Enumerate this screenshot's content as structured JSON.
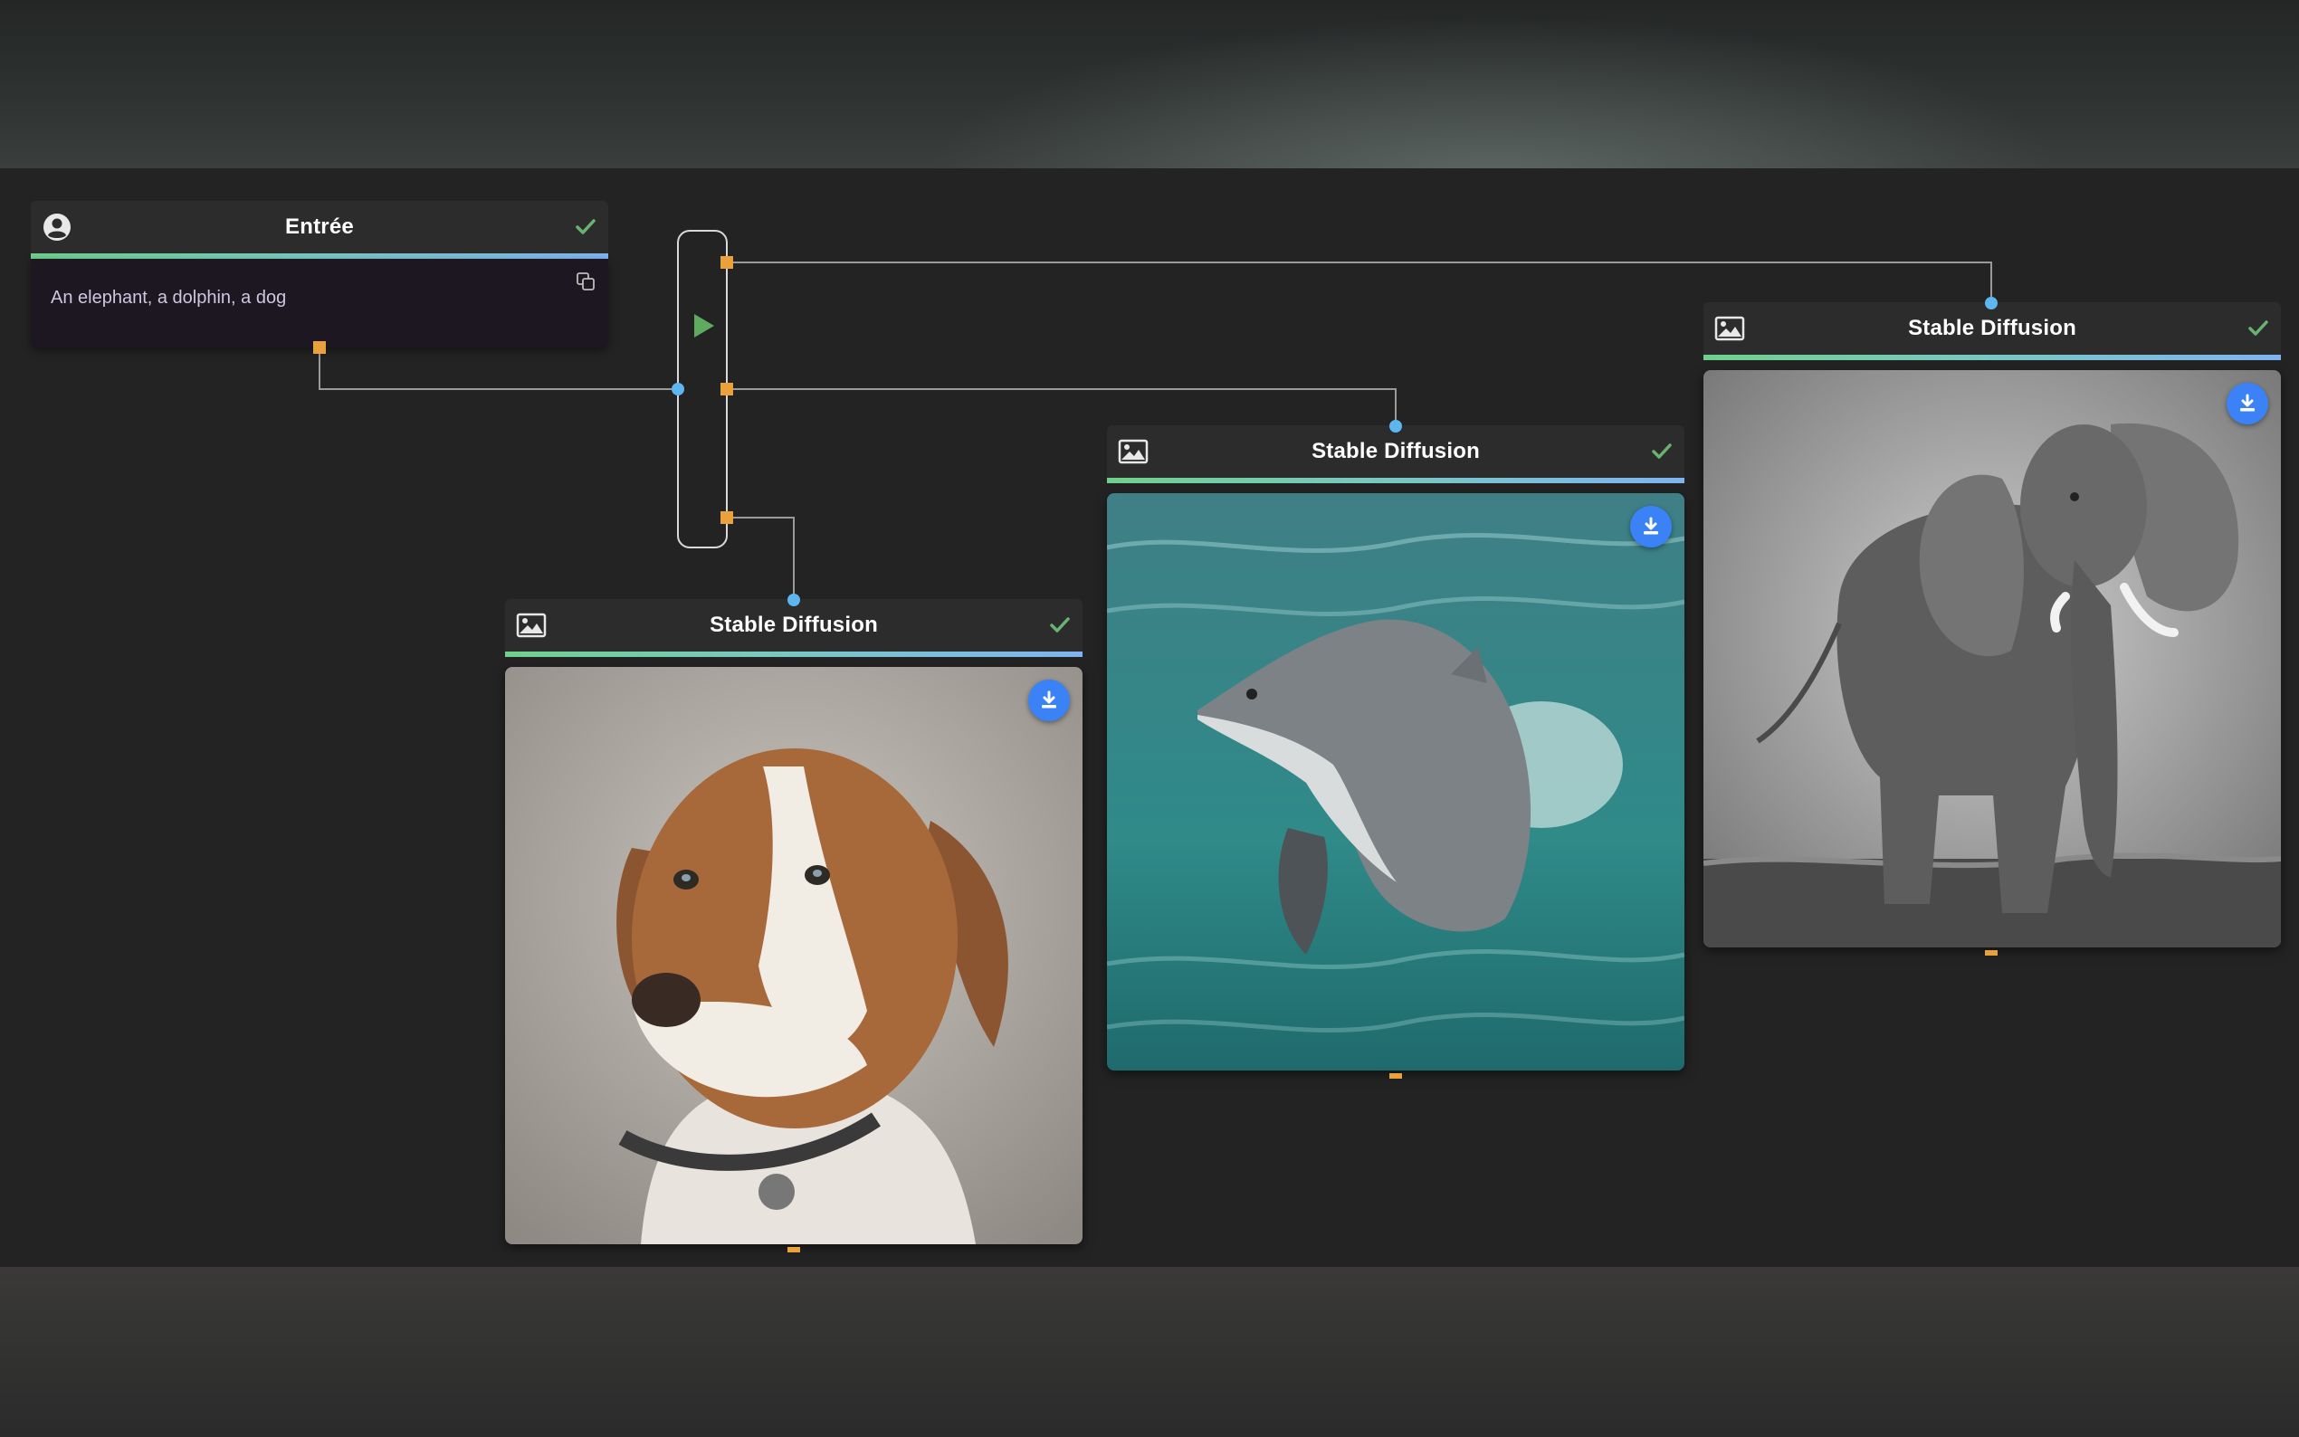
{
  "input_node": {
    "title": "Entrée",
    "prompt_text": "An elephant, a dolphin, a dog",
    "icon": "user-circle-icon",
    "status_icon": "check-icon"
  },
  "splitter": {
    "run_icon": "play-icon"
  },
  "output_nodes": [
    {
      "title": "Stable Diffusion",
      "image_subject": "dog",
      "icon": "image-icon",
      "status_icon": "check-icon",
      "action_icon": "download-icon"
    },
    {
      "title": "Stable Diffusion",
      "image_subject": "dolphin",
      "icon": "image-icon",
      "status_icon": "check-icon",
      "action_icon": "download-icon"
    },
    {
      "title": "Stable Diffusion",
      "image_subject": "elephant",
      "icon": "image-icon",
      "status_icon": "check-icon",
      "action_icon": "download-icon"
    }
  ],
  "colors": {
    "canvas": "#232323",
    "node_header": "#2c2c2c",
    "accent_start": "#6fd08c",
    "accent_end": "#7fb4f0",
    "port_output": "#e9a23b",
    "port_input": "#5db6ef",
    "download_button": "#3b82f6",
    "run_icon": "#5faa5f",
    "check": "#69b36f"
  }
}
